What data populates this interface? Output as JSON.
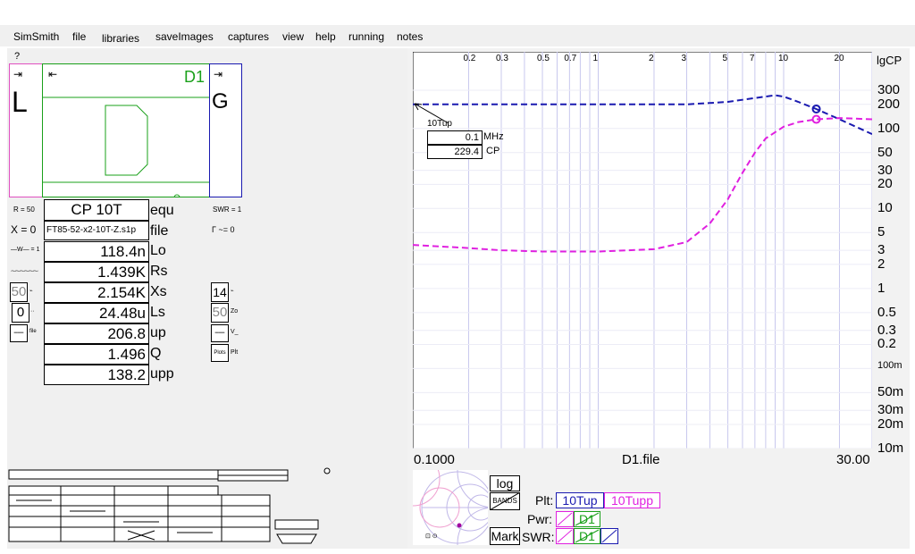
{
  "menu": [
    "SimSmith",
    "file",
    "libraries",
    "saveImages",
    "captures",
    "view",
    "help",
    "running",
    "notes"
  ],
  "circuit": {
    "question": "?",
    "load_label": "L",
    "gen_label": "G",
    "d1_label": "D1",
    "load_color": "#e050c0",
    "d1_color": "#1aa01a",
    "gen_color": "#1a1ab0"
  },
  "left_labels": {
    "r": "R = 50",
    "x": "X = 0",
    "w": "—W— = 1",
    "swr": "SWR = 1",
    "gamma": "Γ ~= 0",
    "z0": "Zo",
    "v": "V_",
    "plts": "Plots",
    "plt": "Plt"
  },
  "left_boxes": {
    "fifty": "50",
    "zero": "0",
    "fourteen": "14",
    "fifty_zo": "50"
  },
  "element": {
    "name": "CP 10T",
    "file": "FT85-52-x2-10T-Z.s1p",
    "rows": [
      {
        "value": "118.4n",
        "label": "Lo"
      },
      {
        "value": "1.439K",
        "label": "Rs"
      },
      {
        "value": "2.154K",
        "label": "Xs"
      },
      {
        "value": "24.48u",
        "label": "Ls"
      },
      {
        "value": "206.8",
        "label": "up"
      },
      {
        "value": "1.496",
        "label": "Q"
      },
      {
        "value": "138.2",
        "label": "upp"
      }
    ],
    "equ_label": "equ",
    "file_label": "file"
  },
  "chart_data": {
    "type": "line",
    "x_scale": "log",
    "xlim": [
      0.1,
      30
    ],
    "y_scale": "log",
    "x_ticks": [
      "0.2",
      "0.3",
      "0.5",
      "0.7",
      "1",
      "2",
      "3",
      "5",
      "7",
      "10",
      "20"
    ],
    "y_ticks": [
      "300",
      "200",
      "100",
      "50",
      "30",
      "20",
      "10",
      "5",
      "3",
      "2",
      "1",
      "0.5",
      "0.3",
      "0.2",
      "100m",
      "50m",
      "30m",
      "20m",
      "10m"
    ],
    "y_header": "lgCP",
    "x_start_label": "0.1000",
    "x_center_label": "D1.file",
    "x_end_label": "30.00",
    "series": [
      {
        "name": "10Tup",
        "color": "#1a1ab0",
        "x": [
          0.1,
          0.3,
          1,
          3,
          5,
          7,
          9,
          10,
          12,
          15,
          20,
          30
        ],
        "y": [
          200,
          200,
          200,
          200,
          215,
          240,
          260,
          250,
          215,
          175,
          130,
          85
        ]
      },
      {
        "name": "10Tupp",
        "color": "#e020e0",
        "x": [
          0.1,
          0.2,
          0.3,
          0.5,
          1,
          2,
          3,
          4,
          5,
          6,
          7,
          8,
          10,
          12,
          15,
          20,
          30
        ],
        "y": [
          3.5,
          3.2,
          3.0,
          2.9,
          2.9,
          3.1,
          3.8,
          6.5,
          13,
          28,
          50,
          75,
          105,
          120,
          130,
          135,
          130
        ]
      }
    ],
    "marker": {
      "label": "10Tup",
      "freq": "0.1",
      "freq_unit": "MHz",
      "value": "229.4",
      "value_unit": "CP"
    }
  },
  "bottom": {
    "log_btn": "log",
    "bands_btn": "BANDS",
    "mark_btn": "Mark",
    "plt_label": "Plt:",
    "pwr_label": "Pwr:",
    "swr_label": "SWR:",
    "plt_1": "10Tup",
    "plt_2": "10Tupp",
    "pwr_d1": "D1",
    "swr_d1": "D1"
  }
}
